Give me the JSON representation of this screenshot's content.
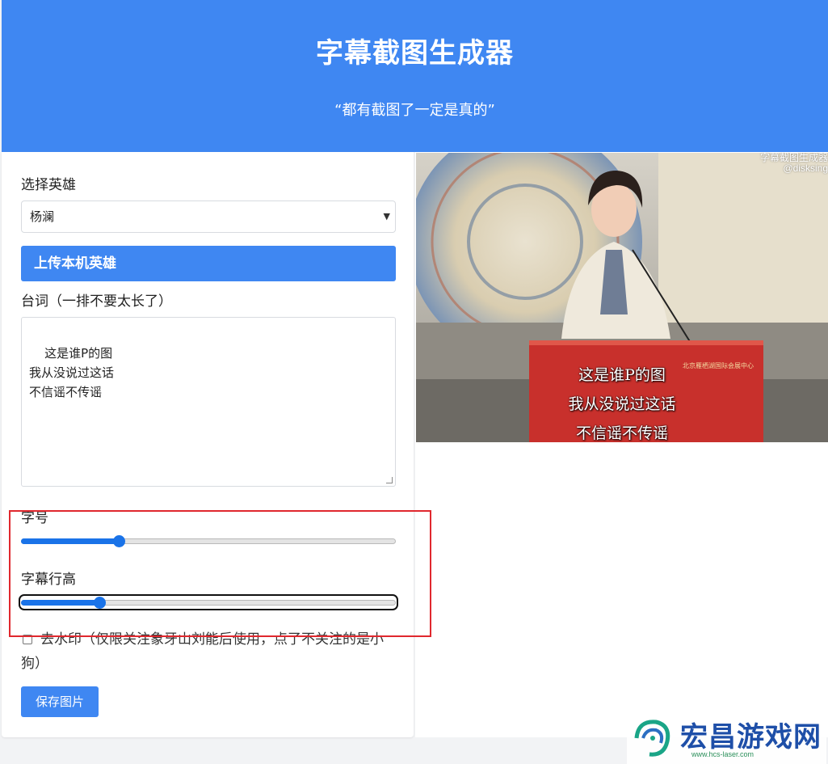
{
  "header": {
    "title": "字幕截图生成器",
    "subtitle": "“都有截图了一定是真的”"
  },
  "form": {
    "hero_label": "选择英雄",
    "hero_selected": "杨澜",
    "upload_button": "上传本机英雄",
    "lines_label": "台词（一排不要太长了）",
    "lines_value": "这是谁P的图\n我从没说过这话\n不信谣不传谣",
    "font_size_label": "字号",
    "font_size_slider_fraction": 0.26,
    "line_height_label": "字幕行高",
    "line_height_slider_fraction": 0.21,
    "watermark_checkbox_label": "去水印（仅限关注象牙山刘能后使用，点了不关注的是小狗）",
    "watermark_checked": false,
    "save_button": "保存图片"
  },
  "preview": {
    "captions": [
      "这是谁P的图",
      "我从没说过这话",
      "不信谣不传谣"
    ],
    "watermark_line1": "字幕截图生成器",
    "watermark_line2": "@disksing",
    "podium_text": "北京雁栖湖国际会展中心"
  },
  "site_logo": {
    "name": "宏昌游戏网",
    "url": "www.hcs-laser.com"
  },
  "colors": {
    "accent": "#3f87f2",
    "slider": "#1a73e8",
    "highlight": "#e0282e"
  }
}
